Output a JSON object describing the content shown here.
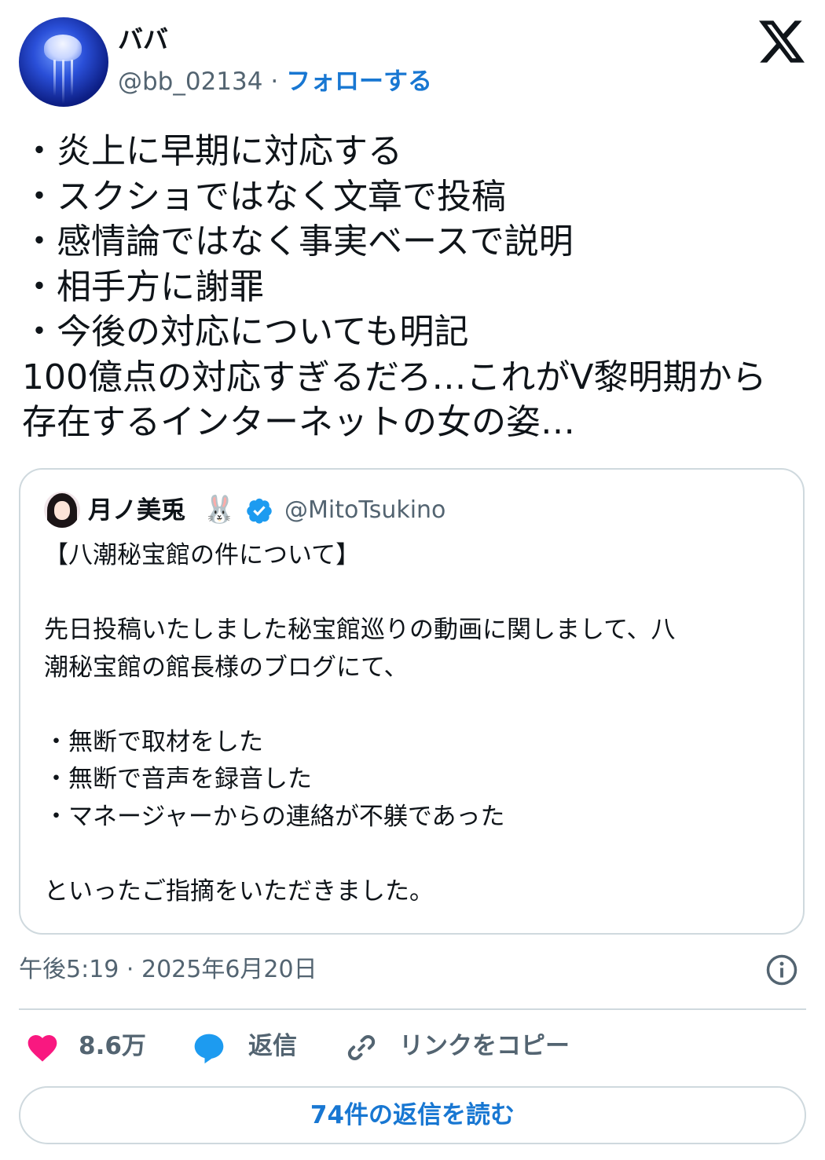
{
  "author": {
    "name": "ババ",
    "handle": "@bb_02134",
    "separator": "·",
    "follow_label": "フォローする"
  },
  "tweet": {
    "lines": [
      "・炎上に早期に対応する",
      "・スクショではなく文章で投稿",
      "・感情論ではなく事実ベースで説明",
      "・相手方に謝罪",
      "・今後の対応についても明記",
      "100億点の対応すぎるだろ…これがV黎明期から",
      "存在するインターネットの女の姿…"
    ]
  },
  "quote": {
    "name": "月ノ美兎",
    "name_emoji": "🐰",
    "handle": "@MitoTsukino",
    "verified_icon": "verified-badge-icon",
    "lines": [
      "【八潮秘宝館の件について】",
      "",
      "先日投稿いたしました秘宝館巡りの動画に関しまして、八",
      "潮秘宝館の館長様のブログにて、",
      "",
      "・無断で取材をした",
      "・無断で音声を録音した",
      "・マネージャーからの連絡が不躾であった",
      "",
      "といったご指摘をいただきました。"
    ]
  },
  "meta": {
    "timestamp": "午後5:19 · 2025年6月20日"
  },
  "actions": {
    "like_count": "8.6万",
    "reply_label": "返信",
    "copy_link_label": "リンクをコピー",
    "read_replies_label": "74件の返信を読む"
  },
  "colors": {
    "accent": "#1877d2",
    "like": "#f91880",
    "reply_icon": "#1d9bf0",
    "muted": "#536471",
    "border": "#cfd9de"
  }
}
